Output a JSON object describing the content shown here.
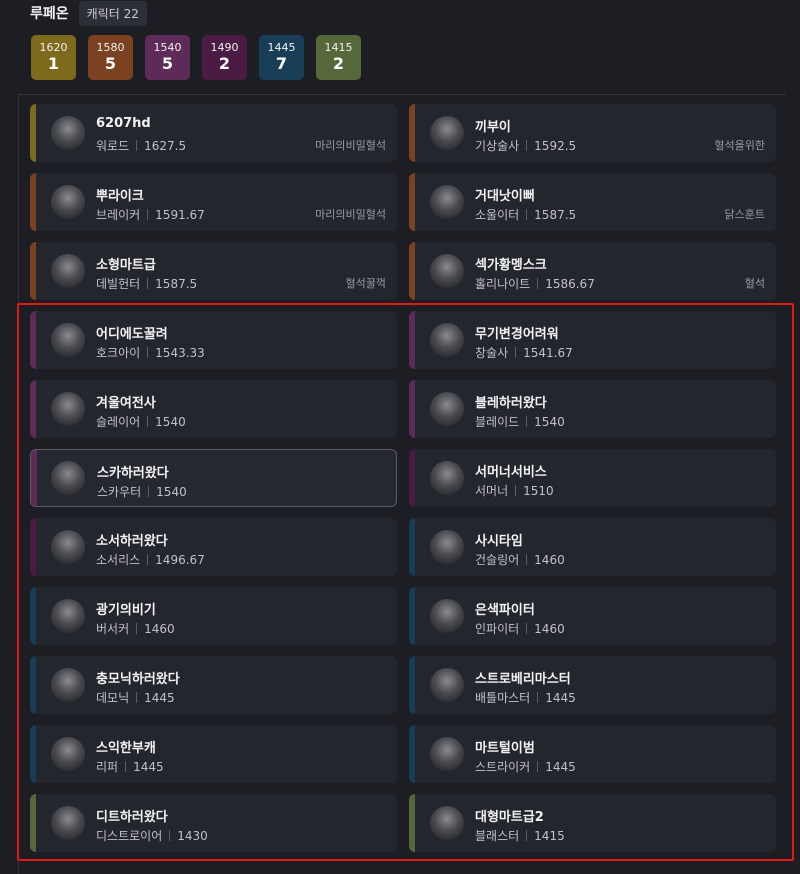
{
  "header": {
    "server": "루페온",
    "char_count_label": "캐릭터 22"
  },
  "tiers": [
    {
      "level": "1620",
      "count": "1",
      "color": "#7e6a1c"
    },
    {
      "level": "1580",
      "count": "5",
      "color": "#7a4220"
    },
    {
      "level": "1540",
      "count": "5",
      "color": "#5e2a57"
    },
    {
      "level": "1490",
      "count": "2",
      "color": "#4b1b43"
    },
    {
      "level": "1445",
      "count": "7",
      "color": "#183d56"
    },
    {
      "level": "1415",
      "count": "2",
      "color": "#56683a"
    }
  ],
  "characters": [
    {
      "name": "6207hd",
      "class": "워로드",
      "level": "1627.5",
      "guild": "마리의비밀혈석",
      "color": "#7e6a1c"
    },
    {
      "name": "끼부이",
      "class": "기상술사",
      "level": "1592.5",
      "guild": "혈석을위한",
      "color": "#7a4220"
    },
    {
      "name": "뿌라이크",
      "class": "브레이커",
      "level": "1591.67",
      "guild": "마리의비밀혈석",
      "color": "#7a4220"
    },
    {
      "name": "거대낫이뻐",
      "class": "소울이터",
      "level": "1587.5",
      "guild": "닭스훈트",
      "color": "#7a4220"
    },
    {
      "name": "소형마트급",
      "class": "데빌헌터",
      "level": "1587.5",
      "guild": "혈석꿀꺽",
      "color": "#7a4220"
    },
    {
      "name": "섹가황멩스크",
      "class": "홀리나이트",
      "level": "1586.67",
      "guild": "혈석",
      "color": "#7a4220"
    },
    {
      "name": "어디에도꿀려",
      "class": "호크아이",
      "level": "1543.33",
      "guild": "",
      "color": "#5e2a57"
    },
    {
      "name": "무기변경어려워",
      "class": "창술사",
      "level": "1541.67",
      "guild": "",
      "color": "#5e2a57"
    },
    {
      "name": "겨울여전사",
      "class": "슬레이어",
      "level": "1540",
      "guild": "",
      "color": "#5e2a57"
    },
    {
      "name": "블레하러왔다",
      "class": "블레이드",
      "level": "1540",
      "guild": "",
      "color": "#5e2a57"
    },
    {
      "name": "스카하러왔다",
      "class": "스카우터",
      "level": "1540",
      "guild": "",
      "color": "#5e2a57"
    },
    {
      "name": "서머너서비스",
      "class": "서머너",
      "level": "1510",
      "guild": "",
      "color": "#4b1b43"
    },
    {
      "name": "소서하러왔다",
      "class": "소서리스",
      "level": "1496.67",
      "guild": "",
      "color": "#4b1b43"
    },
    {
      "name": "사시타임",
      "class": "건슬링어",
      "level": "1460",
      "guild": "",
      "color": "#183d56"
    },
    {
      "name": "광기의비기",
      "class": "버서커",
      "level": "1460",
      "guild": "",
      "color": "#183d56"
    },
    {
      "name": "은색파이터",
      "class": "인파이터",
      "level": "1460",
      "guild": "",
      "color": "#183d56"
    },
    {
      "name": "충모닉하러왔다",
      "class": "데모닉",
      "level": "1445",
      "guild": "",
      "color": "#183d56"
    },
    {
      "name": "스트로베리마스터",
      "class": "배틀마스터",
      "level": "1445",
      "guild": "",
      "color": "#183d56"
    },
    {
      "name": "스익한부캐",
      "class": "리퍼",
      "level": "1445",
      "guild": "",
      "color": "#183d56"
    },
    {
      "name": "마트털이범",
      "class": "스트라이커",
      "level": "1445",
      "guild": "",
      "color": "#183d56"
    },
    {
      "name": "디트하러왔다",
      "class": "디스트로이어",
      "level": "1430",
      "guild": "",
      "color": "#56683a"
    },
    {
      "name": "대형마트급2",
      "class": "블래스터",
      "level": "1415",
      "guild": "",
      "color": "#56683a"
    }
  ],
  "selected_index": 10,
  "highlight_color": "#e01818"
}
